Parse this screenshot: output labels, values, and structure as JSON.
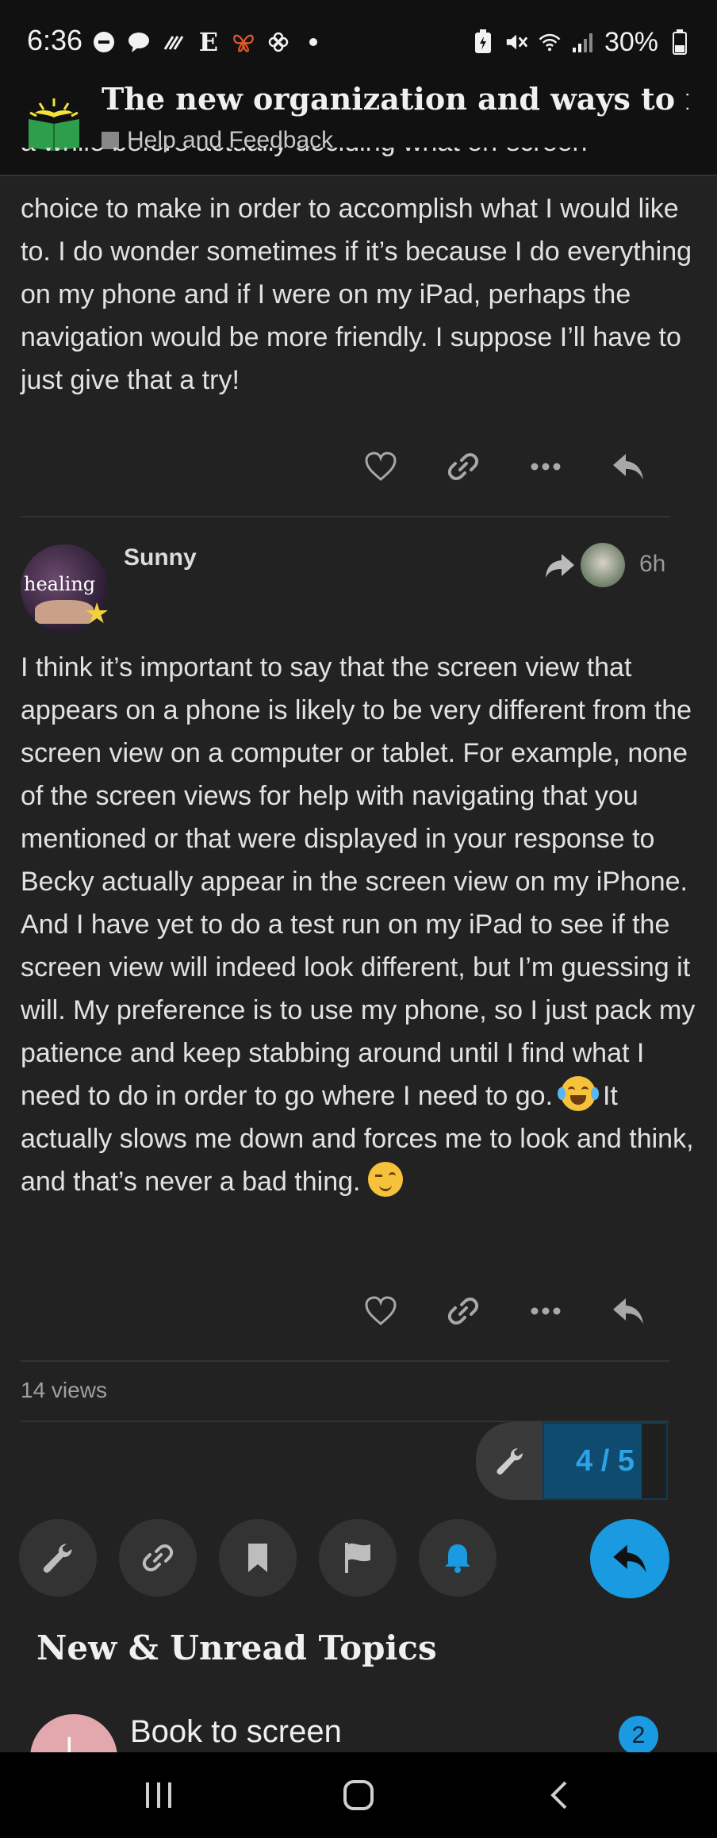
{
  "status_bar": {
    "time": "6:36",
    "left_icons": [
      "minus-circle-icon",
      "chat-bubble-icon",
      "signal-lines-icon",
      "letter-e-icon",
      "butterfly-icon",
      "pinwheel-icon",
      "dot-icon"
    ],
    "left_icon_chars": {
      "letter_e": "E"
    },
    "battery": "30%",
    "right_icons": [
      "battery-saver-icon",
      "mute-icon",
      "wifi-icon",
      "cell-signal-icon",
      "battery-icon"
    ]
  },
  "header": {
    "title": "The new organization and ways to n...",
    "category": "Help and Feedback",
    "category_color": "#888888",
    "logo_icon": "open-book-icon"
  },
  "previous_post": {
    "cut_line": "a while before actually deciding what on-screen",
    "text": "choice to make in order to accomplish what I would like to. I do wonder sometimes if it’s because I do everything on my phone and if I were on my iPad, perhaps the navigation would be more friendly. I suppose I’ll have to just give that a try!"
  },
  "post": {
    "author": "Sunny",
    "avatar_text": "healing",
    "time": "6h",
    "text_a": "I think it’s important to say that the screen view that appears on a phone is likely to be very different from the screen view on a computer or tablet. For example, none of the screen views for help with navigating that you mentioned or that were displayed in your response to Becky actually appear in the screen view on my iPhone. And I have yet to do a test run on my iPad to see if the screen view will indeed look different, but I’m guessing it will. My preference is to use my phone, so I just pack my patience and keep stabbing around until I find what I need to do in order to go where I need to go.",
    "text_b": " It actually slows me down and forces me to look and think, and that’s never a bad thing. ",
    "emoji_1": "laughing-with-tears-emoji",
    "emoji_2": "winking-emoji"
  },
  "post_actions": [
    "like-icon",
    "link-icon",
    "more-icon",
    "reply-icon"
  ],
  "views": "14 views",
  "progress": {
    "current": 4,
    "total": 5,
    "label": "4 / 5",
    "fraction": 0.8
  },
  "bottom_tools": [
    "wrench-icon",
    "link-icon",
    "bookmark-icon",
    "flag-icon",
    "bell-icon"
  ],
  "colors": {
    "accent": "#1a9ae0",
    "background": "#222222"
  },
  "section": {
    "title": "New & Unread Topics"
  },
  "topics": [
    {
      "title": "Book to screen",
      "badge": "2",
      "avatar_letter": "L"
    }
  ],
  "nav_bar": [
    "recent-apps-icon",
    "home-icon",
    "back-icon"
  ]
}
